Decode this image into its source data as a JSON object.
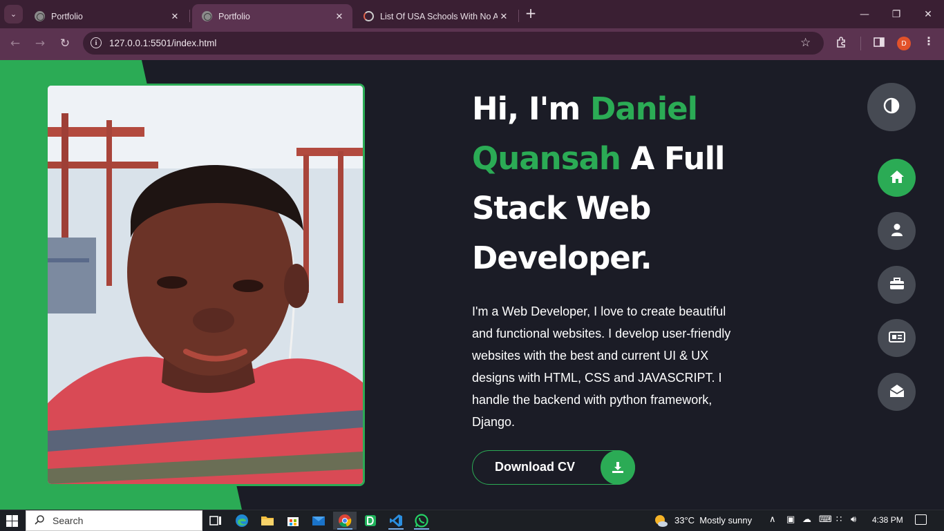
{
  "browser": {
    "tabs": [
      {
        "title": "Portfolio",
        "active": false
      },
      {
        "title": "Portfolio",
        "active": true
      },
      {
        "title": "List Of USA Schools With No Ap",
        "active": false
      }
    ],
    "url": "127.0.0.1:5501/index.html",
    "profile_initial": "D"
  },
  "hero": {
    "greeting": "Hi, I'm ",
    "name": "Daniel Quansah",
    "title_rest": " A Full Stack Web Developer.",
    "description": "I'm a Web Developer, I love to create beautiful and functional websites. I develop user-friendly websites with the best and current UI & UX designs with HTML, CSS and JAVASCRIPT. I handle the backend with python framework, Django.",
    "cv_button": "Download CV"
  },
  "side_nav": {
    "theme_icon": "contrast-icon",
    "items": [
      {
        "icon": "home-icon",
        "active": true
      },
      {
        "icon": "user-icon",
        "active": false
      },
      {
        "icon": "briefcase-icon",
        "active": false
      },
      {
        "icon": "newspaper-icon",
        "active": false
      },
      {
        "icon": "envelope-open-icon",
        "active": false
      }
    ]
  },
  "colors": {
    "accent": "#2bab55",
    "page_bg": "#1b1c26",
    "nav_btn_bg": "#464a53"
  },
  "taskbar": {
    "search_placeholder": "Search",
    "weather_temp": "33°C",
    "weather_desc": "Mostly sunny",
    "time": "4:38 PM"
  }
}
